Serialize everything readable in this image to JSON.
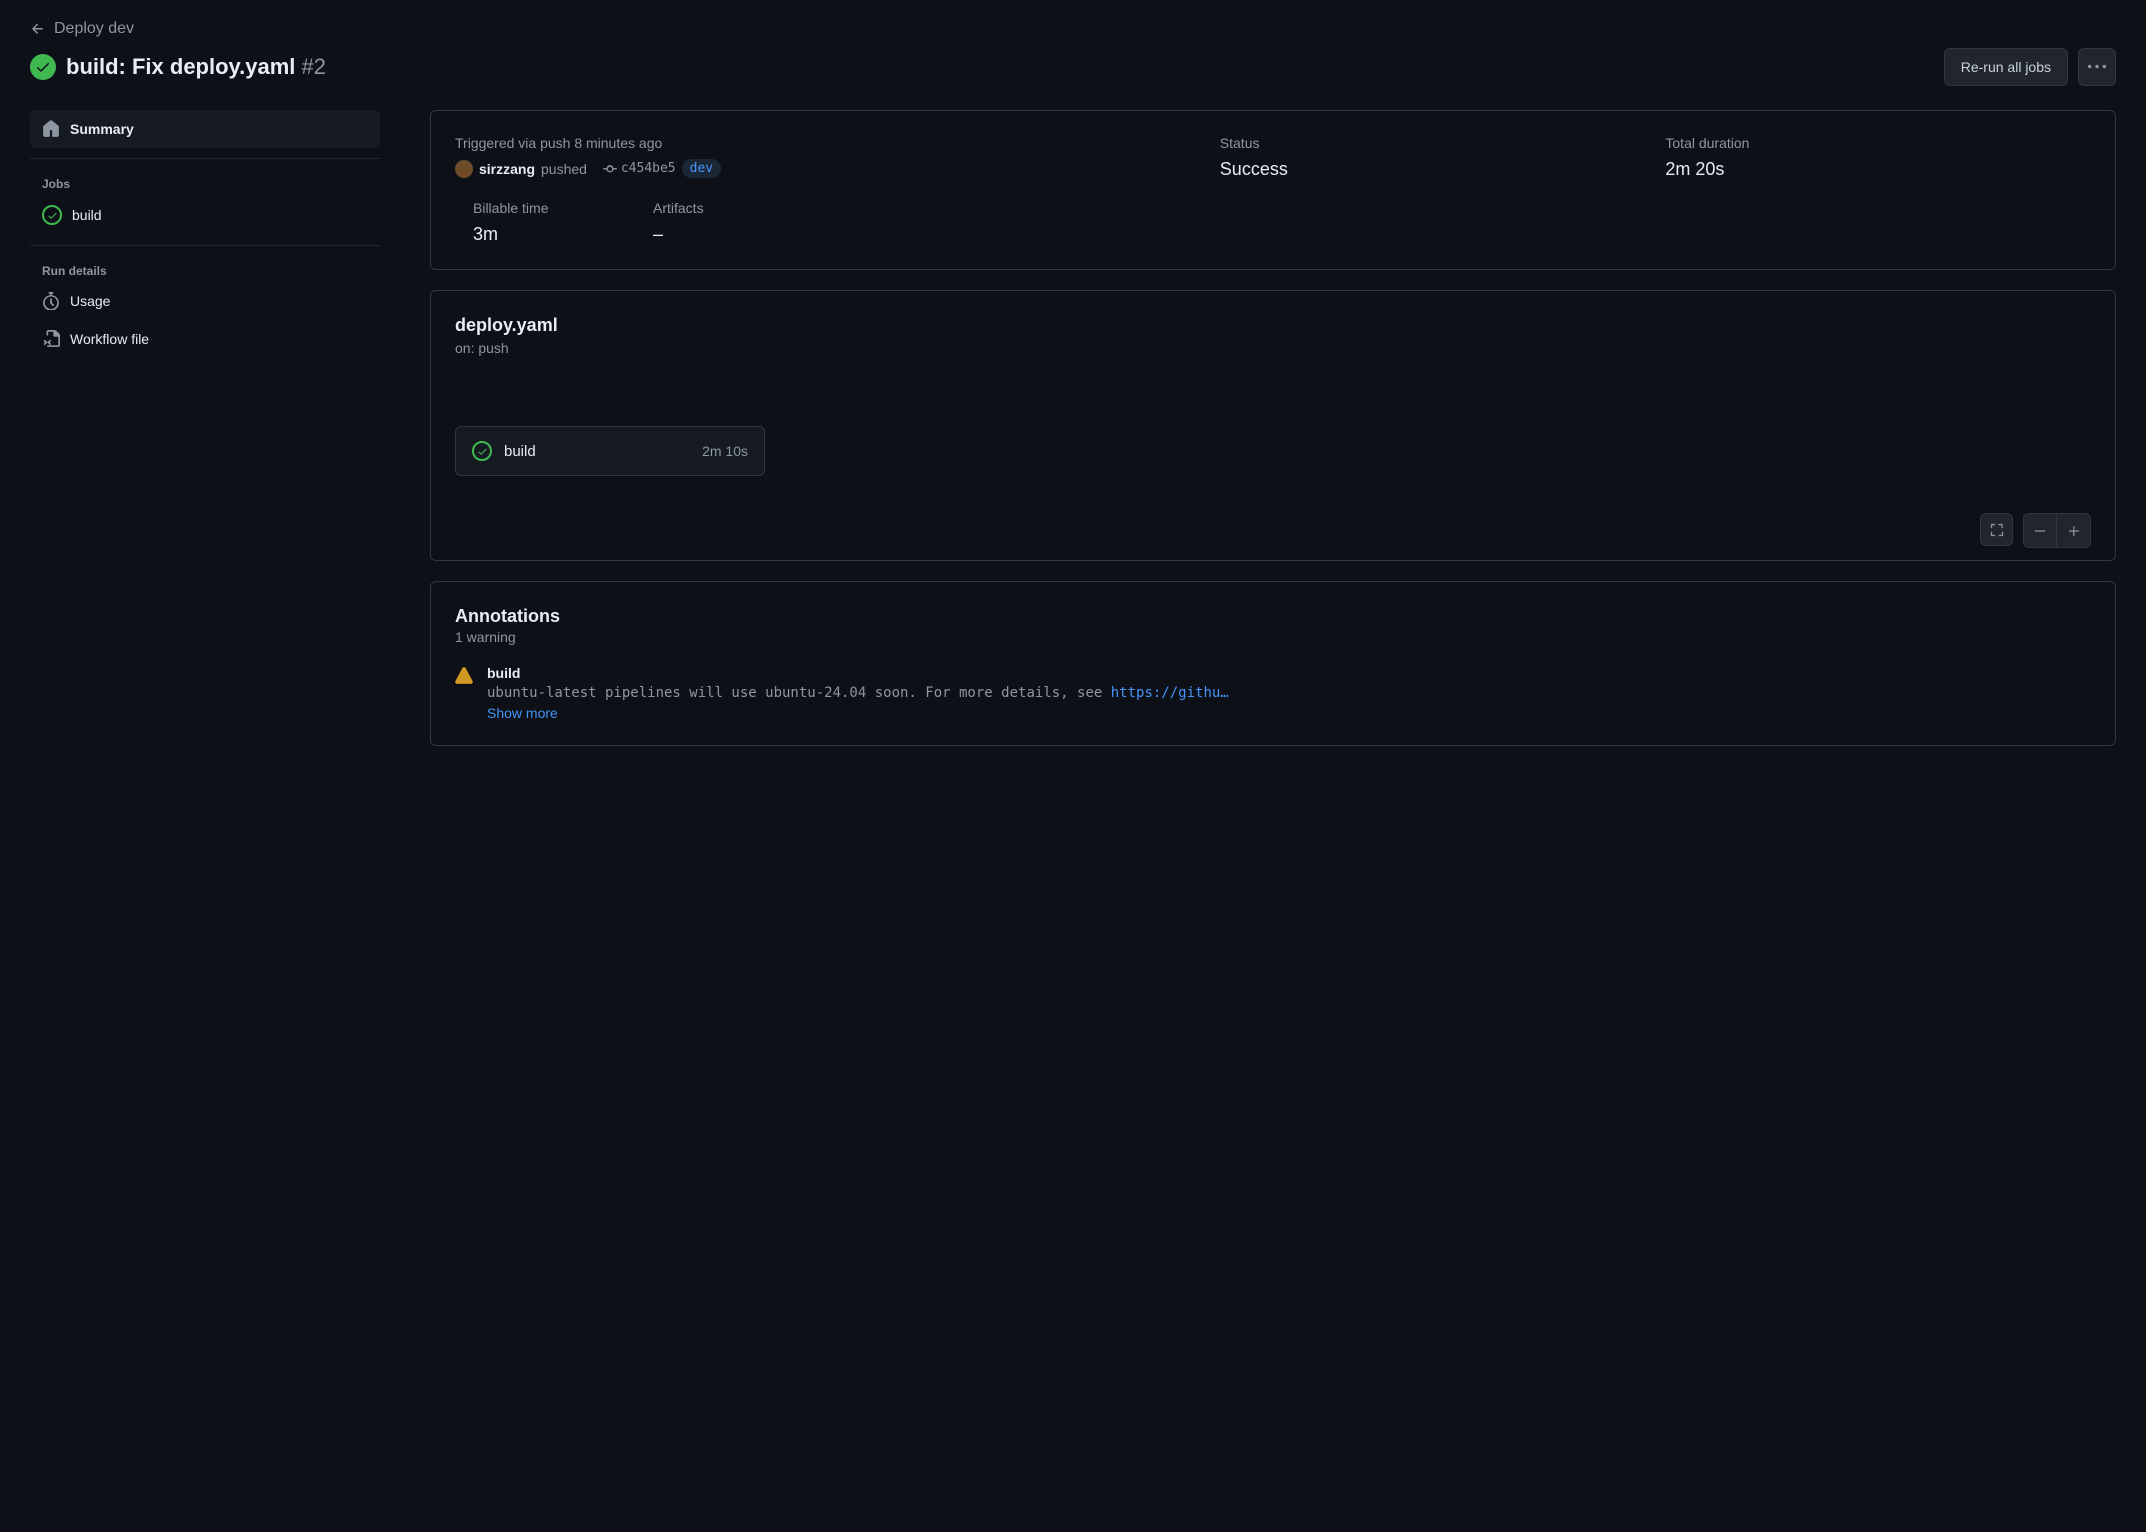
{
  "nav": {
    "back_label": "Deploy dev"
  },
  "header": {
    "title": "build: Fix deploy.yaml",
    "run_number": "#2",
    "rerun_label": "Re-run all jobs"
  },
  "sidebar": {
    "summary_label": "Summary",
    "jobs_heading": "Jobs",
    "job_name": "build",
    "run_details_heading": "Run details",
    "usage_label": "Usage",
    "workflow_file_label": "Workflow file"
  },
  "summary": {
    "trigger_text": "Triggered via push 8 minutes ago",
    "user": "sirzzang",
    "pushed_text": "pushed",
    "commit_sha": "c454be5",
    "branch": "dev",
    "status_label": "Status",
    "status_value": "Success",
    "duration_label": "Total duration",
    "duration_value": "2m 20s",
    "billable_label": "Billable time",
    "billable_value": "3m",
    "artifacts_label": "Artifacts",
    "artifacts_value": "–"
  },
  "workflow": {
    "file": "deploy.yaml",
    "trigger": "on: push",
    "job_name": "build",
    "job_duration": "2m 10s"
  },
  "annotations": {
    "title": "Annotations",
    "subtitle": "1 warning",
    "item_name": "build",
    "item_msg_pre": "ubuntu-latest pipelines will use ubuntu-24.04 soon. For more details, see ",
    "item_msg_link": "https://githu…",
    "show_more": "Show more"
  }
}
